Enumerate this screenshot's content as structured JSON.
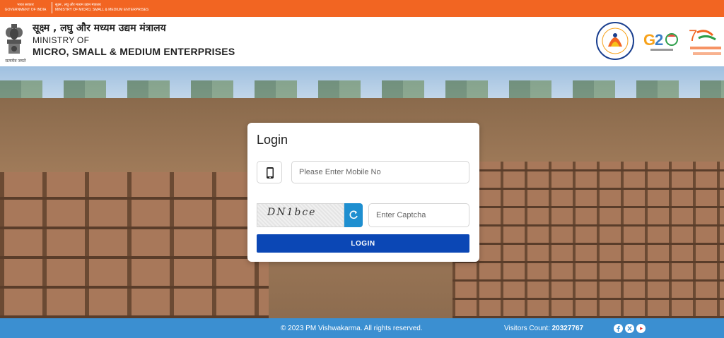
{
  "top_strip": {
    "gov_hindi": "भारत सरकार",
    "gov_english": "GOVERNMENT OF INDIA",
    "ministry_hindi": "सूक्ष्म , लघु और मध्यम उद्यम मंत्रालय",
    "ministry_english": "MINISTRY OF MICRO, SMALL & MEDIUM ENTERPRISES"
  },
  "header": {
    "ministry_hindi": "सूक्ष्म , लघु और मध्यम उद्यम मंत्रालय",
    "ministry_line1": "MINISTRY OF",
    "ministry_line2": "MICRO, SMALL & MEDIUM ENTERPRISES",
    "emblem_caption": "सत्यमेव जयते",
    "logos": [
      "pm-vishwakarma-logo",
      "g20-logo",
      "azadi-ka-amrit-mahotsav-logo"
    ]
  },
  "login": {
    "title": "Login",
    "mobile_placeholder": "Please Enter Mobile No",
    "captcha_text": "DN1bce",
    "captcha_placeholder": "Enter Captcha",
    "button_label": "LOGIN"
  },
  "footer": {
    "copyright": "© 2023 PM Vishwakarma. All rights reserved.",
    "visitors_label": "Visitors Count:",
    "visitors_count": "20327767",
    "social_icons": [
      "facebook-icon",
      "x-twitter-icon",
      "youtube-icon"
    ]
  },
  "colors": {
    "top_strip": "#f26522",
    "primary_button": "#0b47b5",
    "refresh_button": "#1e8fd0",
    "footer": "#3b8fd1"
  }
}
